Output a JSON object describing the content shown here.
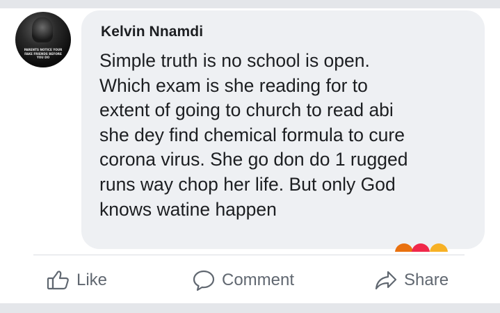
{
  "comment": {
    "author": "Kelvin Nnamdi",
    "text": "Simple truth is no school is open.\nWhich exam is she reading for to\nextent of going to church to read abi\nshe dey find chemical formula to cure\ncorona virus. She go don do 1 rugged\nruns way chop her life. But only God\nknows watine happen",
    "avatar_caption": "PARENTS NOTICE YOUR FAKE FRIENDS BEFORE YOU DO"
  },
  "reactions": [
    "haha",
    "love",
    "wow"
  ],
  "actions": {
    "like_label": "Like",
    "comment_label": "Comment",
    "share_label": "Share"
  },
  "colors": {
    "bubble": "#eef0f3",
    "text": "#1c1e21",
    "action": "#606770",
    "band": "#e4e6ea"
  }
}
